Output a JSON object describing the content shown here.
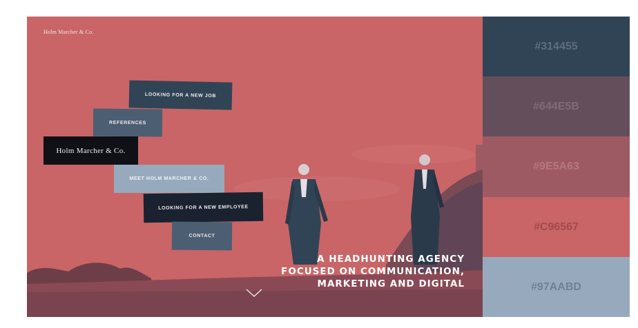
{
  "brand": {
    "name": "Holm Marcher & Co."
  },
  "menu": {
    "new_job": "LOOKING FOR A NEW JOB",
    "references": "REFERENCES",
    "logo_block": "Holm Marcher & Co.",
    "meet": "MEET HOLM MARCHER & CO.",
    "new_employee": "LOOKING FOR A NEW EMPLOYEE",
    "contact": "CONTACT"
  },
  "hero": {
    "tagline_line1": "A HEADHUNTING AGENCY",
    "tagline_line2": "FOCUSED ON COMMUNICATION,",
    "tagline_line3": "MARKETING AND DIGITAL",
    "scroll_icon": "chevron-down-icon"
  },
  "palette": {
    "swatches": [
      {
        "label": "#314455",
        "color": "#314455"
      },
      {
        "label": "#644E5B",
        "color": "#644e5b"
      },
      {
        "label": "#9E5A63",
        "color": "#9e5a63"
      },
      {
        "label": "#C96567",
        "color": "#c96567"
      },
      {
        "label": "#97AABD",
        "color": "#97aabd"
      }
    ]
  }
}
